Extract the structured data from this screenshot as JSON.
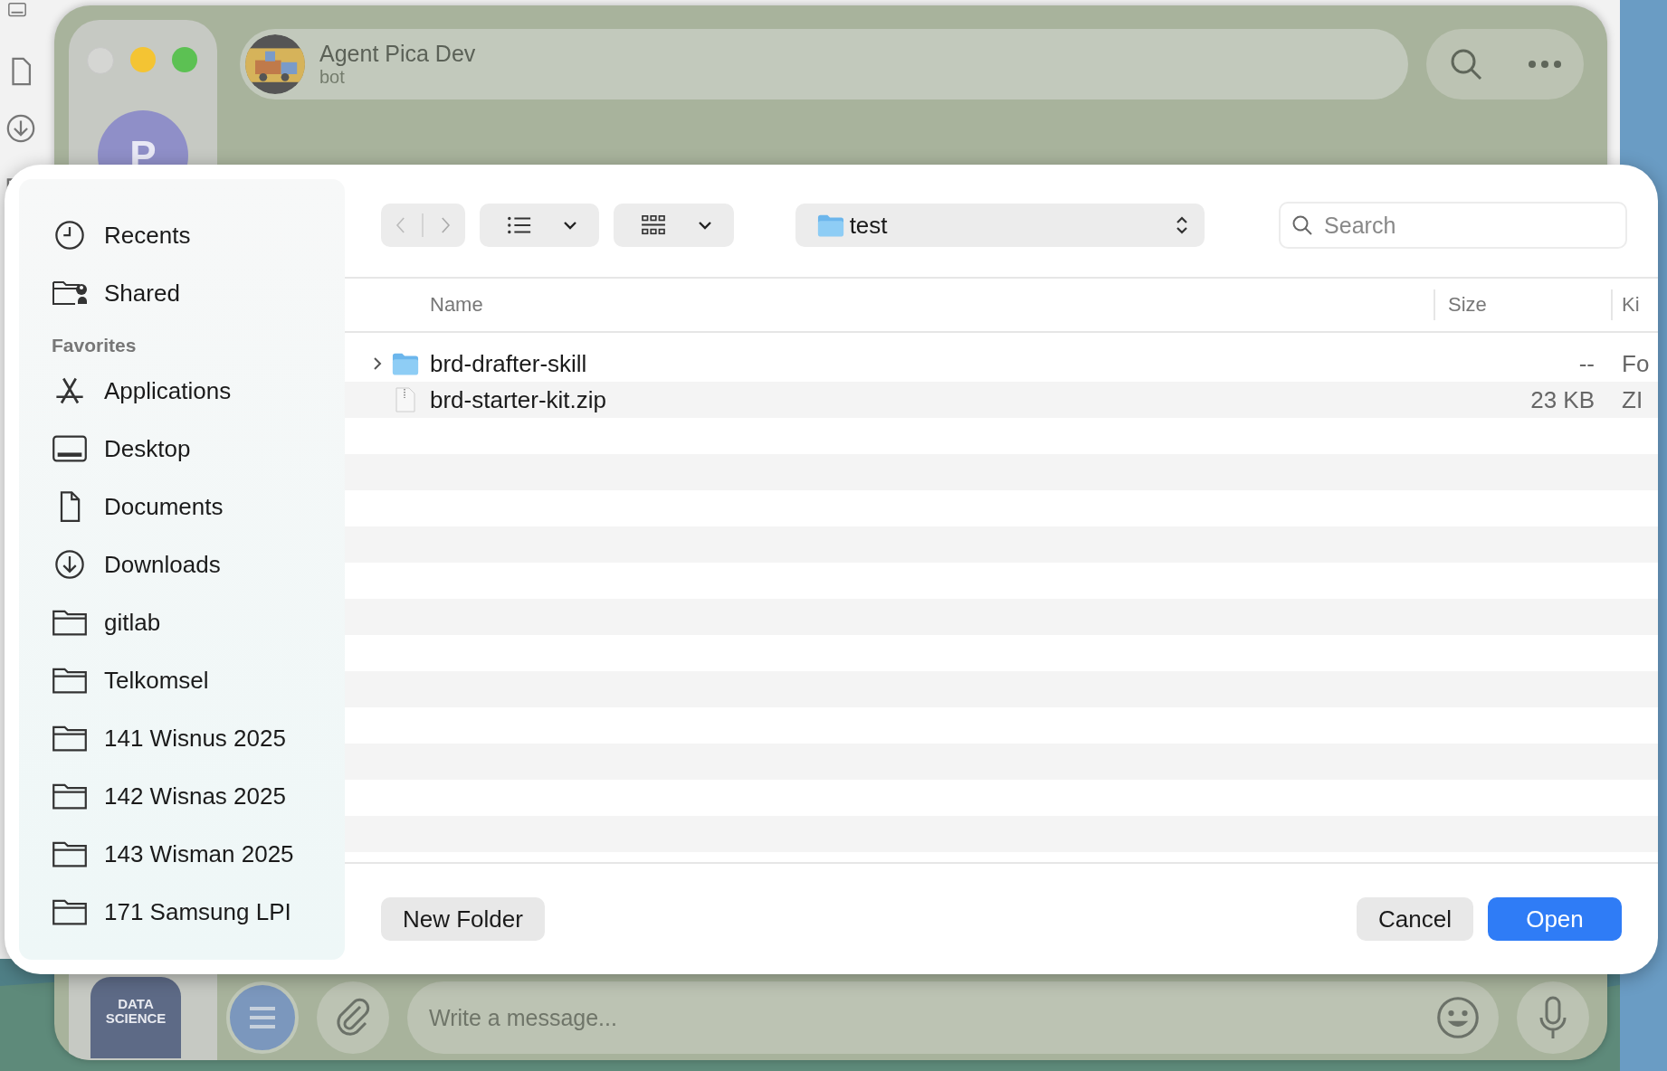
{
  "chat": {
    "title": "Agent Pica Dev",
    "subtitle": "bot",
    "account_avatar": "P",
    "channel_avatar": [
      "DATA",
      "SCIENCE"
    ],
    "composer": {
      "placeholder": "Write a message..."
    }
  },
  "dialog": {
    "sidebar": {
      "items": [
        {
          "kind": "clock",
          "label": "Recents"
        },
        {
          "kind": "shared",
          "label": "Shared"
        }
      ],
      "sections": [
        {
          "title": "Favorites",
          "items": [
            {
              "kind": "apps",
              "label": "Applications"
            },
            {
              "kind": "desktop",
              "label": "Desktop"
            },
            {
              "kind": "doc",
              "label": "Documents"
            },
            {
              "kind": "download",
              "label": "Downloads"
            },
            {
              "kind": "folder",
              "label": "gitlab"
            },
            {
              "kind": "folder",
              "label": "Telkomsel"
            },
            {
              "kind": "folder",
              "label": "141 Wisnus 2025"
            },
            {
              "kind": "folder",
              "label": "142 Wisnas 2025"
            },
            {
              "kind": "folder",
              "label": "143 Wisman 2025"
            },
            {
              "kind": "folder",
              "label": "171 Samsung LPI"
            }
          ]
        }
      ]
    },
    "toolbar": {
      "location": "test",
      "search": {
        "placeholder": "Search"
      }
    },
    "table": {
      "columns": [
        "Name",
        "Size",
        "Ki"
      ],
      "rows": [
        {
          "kind": "folder",
          "expanded": false,
          "name": "brd-drafter-skill",
          "size": "--",
          "type": "Fo"
        },
        {
          "kind": "zip",
          "name": "brd-starter-kit.zip",
          "size": "23 KB",
          "type": "ZI"
        }
      ]
    },
    "buttons": [
      {
        "kind": "secondary",
        "label": "New Folder"
      },
      {
        "kind": "secondary",
        "label": "Cancel"
      },
      {
        "kind": "primary",
        "label": "Open"
      }
    ]
  }
}
